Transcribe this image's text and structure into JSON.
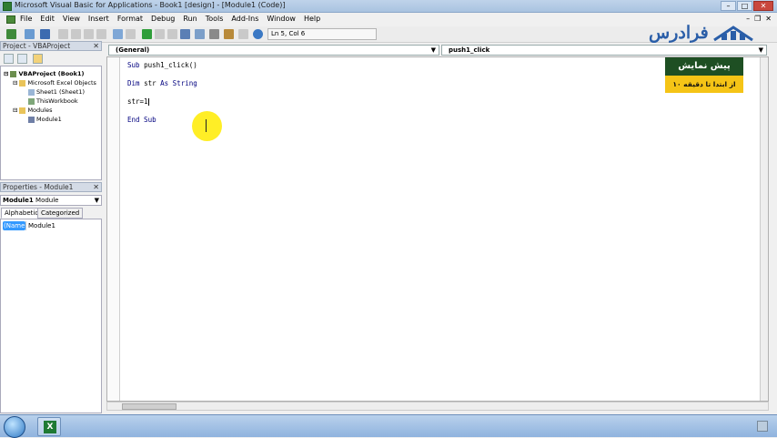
{
  "window": {
    "title": "Microsoft Visual Basic for Applications - Book1 [design] - [Module1 (Code)]"
  },
  "menu": {
    "items": [
      "File",
      "Edit",
      "View",
      "Insert",
      "Format",
      "Debug",
      "Run",
      "Tools",
      "Add-Ins",
      "Window",
      "Help"
    ]
  },
  "status": {
    "position": "Ln 5, Col 6"
  },
  "project": {
    "title": "Project - VBAProject",
    "tree": [
      {
        "label": "VBAProject (Book1)",
        "icon": "project-icon",
        "level": 0
      },
      {
        "label": "Microsoft Excel Objects",
        "icon": "folder-icon",
        "level": 1
      },
      {
        "label": "Sheet1 (Sheet1)",
        "icon": "sheet-icon",
        "level": 2
      },
      {
        "label": "ThisWorkbook",
        "icon": "workbook-icon",
        "level": 2
      },
      {
        "label": "Modules",
        "icon": "folder-icon",
        "level": 1
      },
      {
        "label": "Module1",
        "icon": "module-icon",
        "level": 2
      }
    ]
  },
  "properties": {
    "title": "Properties - Module1",
    "selector_name": "Module1",
    "selector_type": "Module",
    "tabs": [
      "Alphabetic",
      "Categorized"
    ],
    "row": {
      "name": "(Name)",
      "value": "Module1"
    }
  },
  "code": {
    "object_combo": "(General)",
    "proc_combo": "push1_click",
    "lines": [
      "Sub push1_click()",
      "Dim str As String",
      "str=1",
      "End Sub"
    ]
  },
  "watermark": {
    "logo_text": "فرادرس",
    "promo_title": "پیش نمایش",
    "promo_subtitle": "از ابتدا تا دقیقه ۱۰"
  },
  "colors": {
    "promo_top": "#1e4f23",
    "promo_bottom": "#f5c416",
    "highlight": "#ffeb00",
    "keyword": "#00007f"
  }
}
